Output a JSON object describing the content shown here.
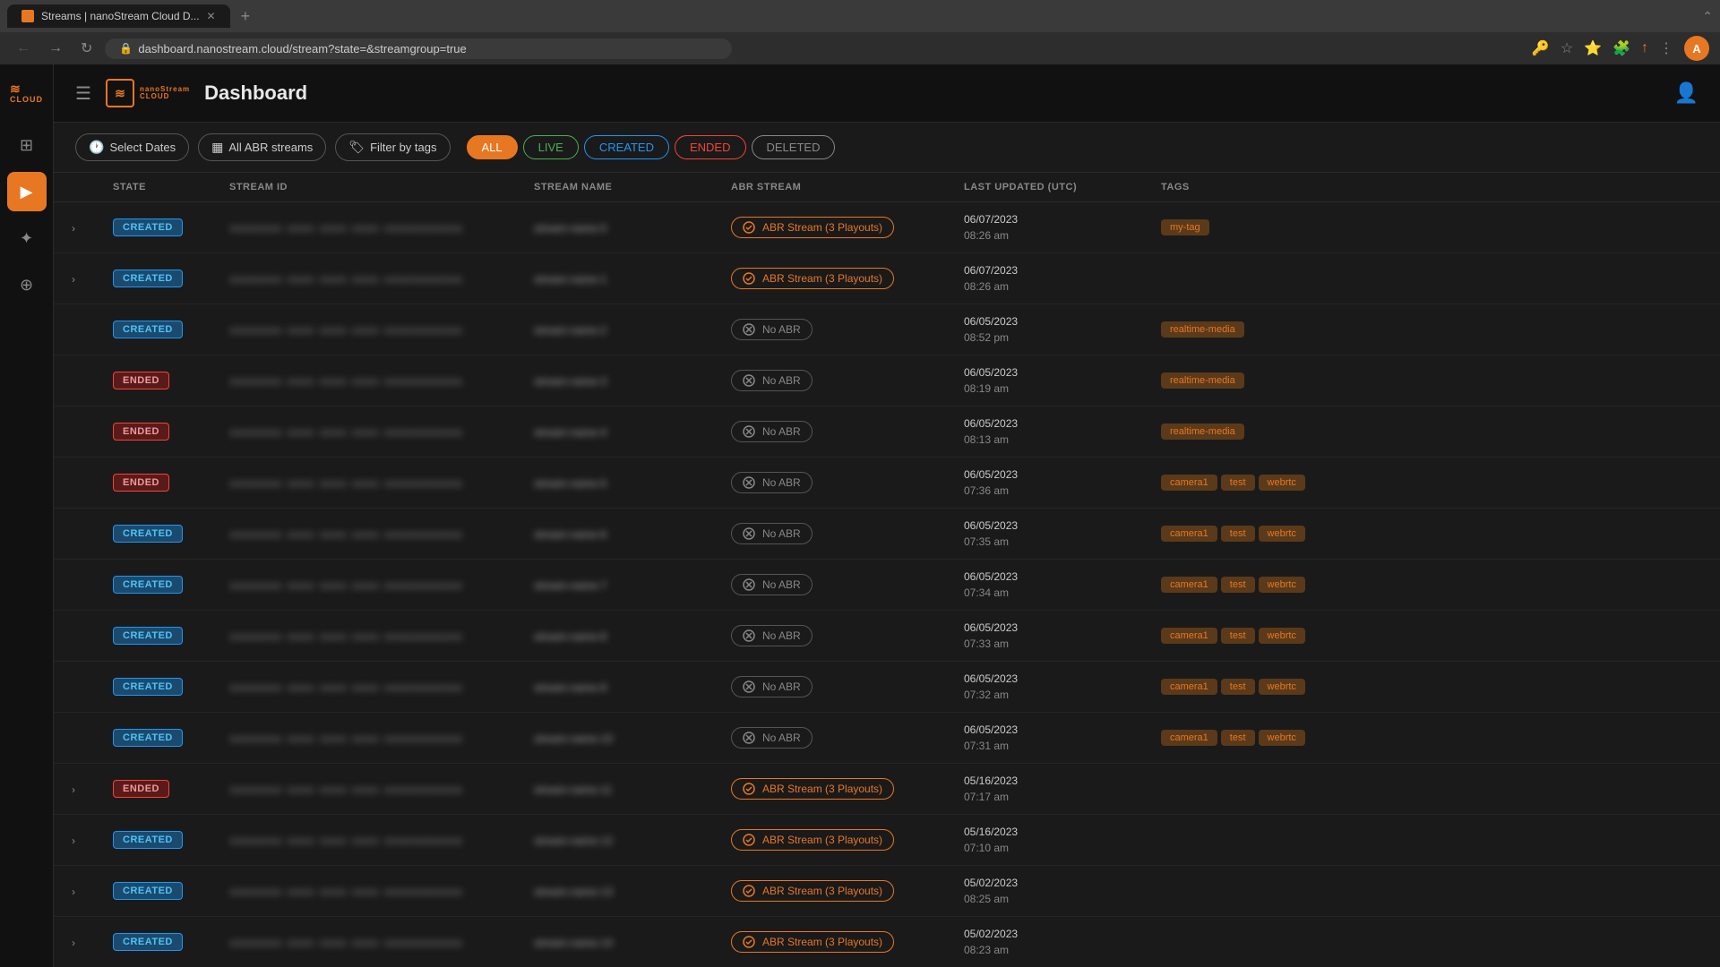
{
  "browser": {
    "tab_label": "Streams | nanoStream Cloud D...",
    "url": "dashboard.nanostream.cloud/stream?state=&streamgroup=true",
    "new_tab_label": "+",
    "profile_initial": "A"
  },
  "header": {
    "title": "Dashboard",
    "hamburger_label": "☰",
    "user_icon": "👤"
  },
  "toolbar": {
    "select_dates_label": "Select Dates",
    "all_abr_streams_label": "All ABR streams",
    "filter_by_tags_label": "Filter by tags",
    "tabs": [
      {
        "id": "all",
        "label": "ALL",
        "state": "active-all"
      },
      {
        "id": "live",
        "label": "LIVE",
        "state": "active-live"
      },
      {
        "id": "created",
        "label": "CREATED",
        "state": "active-created"
      },
      {
        "id": "ended",
        "label": "ENDED",
        "state": "active-ended"
      },
      {
        "id": "deleted",
        "label": "DELETED",
        "state": "active-deleted"
      }
    ]
  },
  "table": {
    "columns": [
      "",
      "STATE",
      "STREAM ID",
      "STREAM NAME",
      "ABR STREAM",
      "LAST UPDATED (UTC)",
      "TAGS"
    ],
    "rows": [
      {
        "expandable": true,
        "state": "CREATED",
        "stream_id": "██████████████████████████████",
        "stream_name": "████████████",
        "abr": "abr",
        "abr_label": "ABR Stream (3 Playouts)",
        "date": "06/07/2023",
        "time": "08:26 am",
        "tags": [
          "my-tag"
        ]
      },
      {
        "expandable": true,
        "state": "CREATED",
        "stream_id": "██████████████████████████████",
        "stream_name": "████████████",
        "abr": "abr",
        "abr_label": "ABR Stream (3 Playouts)",
        "date": "06/07/2023",
        "time": "08:26 am",
        "tags": []
      },
      {
        "expandable": false,
        "state": "CREATED",
        "stream_id": "██████████████████████████████",
        "stream_name": "████████████",
        "abr": "none",
        "abr_label": "No ABR",
        "date": "06/05/2023",
        "time": "08:52 pm",
        "tags": [
          "realtime-media"
        ]
      },
      {
        "expandable": false,
        "state": "ENDED",
        "stream_id": "██████████████████████████████",
        "stream_name": "████████████",
        "abr": "none",
        "abr_label": "No ABR",
        "date": "06/05/2023",
        "time": "08:19 am",
        "tags": [
          "realtime-media"
        ]
      },
      {
        "expandable": false,
        "state": "ENDED",
        "stream_id": "██████████████████████████████",
        "stream_name": "████████████",
        "abr": "none",
        "abr_label": "No ABR",
        "date": "06/05/2023",
        "time": "08:13 am",
        "tags": [
          "realtime-media"
        ]
      },
      {
        "expandable": false,
        "state": "ENDED",
        "stream_id": "██████████████████████████████",
        "stream_name": "████████████",
        "abr": "none",
        "abr_label": "No ABR",
        "date": "06/05/2023",
        "time": "07:36 am",
        "tags": [
          "camera1",
          "test",
          "webrtc"
        ]
      },
      {
        "expandable": false,
        "state": "CREATED",
        "stream_id": "██████████████████████████████",
        "stream_name": "████████████",
        "abr": "none",
        "abr_label": "No ABR",
        "date": "06/05/2023",
        "time": "07:35 am",
        "tags": [
          "camera1",
          "test",
          "webrtc"
        ]
      },
      {
        "expandable": false,
        "state": "CREATED",
        "stream_id": "██████████████████████████████",
        "stream_name": "████████████",
        "abr": "none",
        "abr_label": "No ABR",
        "date": "06/05/2023",
        "time": "07:34 am",
        "tags": [
          "camera1",
          "test",
          "webrtc"
        ]
      },
      {
        "expandable": false,
        "state": "CREATED",
        "stream_id": "██████████████████████████████",
        "stream_name": "████████████",
        "abr": "none",
        "abr_label": "No ABR",
        "date": "06/05/2023",
        "time": "07:33 am",
        "tags": [
          "camera1",
          "test",
          "webrtc"
        ]
      },
      {
        "expandable": false,
        "state": "CREATED",
        "stream_id": "██████████████████████████████",
        "stream_name": "████████████",
        "abr": "none",
        "abr_label": "No ABR",
        "date": "06/05/2023",
        "time": "07:32 am",
        "tags": [
          "camera1",
          "test",
          "webrtc"
        ]
      },
      {
        "expandable": false,
        "state": "CREATED",
        "stream_id": "██████████████████████████████",
        "stream_name": "████████████",
        "abr": "none",
        "abr_label": "No ABR",
        "date": "06/05/2023",
        "time": "07:31 am",
        "tags": [
          "camera1",
          "test",
          "webrtc"
        ]
      },
      {
        "expandable": true,
        "state": "ENDED",
        "stream_id": "██████████████████████████████",
        "stream_name": "████████████",
        "abr": "abr",
        "abr_label": "ABR Stream (3 Playouts)",
        "date": "05/16/2023",
        "time": "07:17 am",
        "tags": []
      },
      {
        "expandable": true,
        "state": "CREATED",
        "stream_id": "██████████████████████████████",
        "stream_name": "████████████",
        "abr": "abr",
        "abr_label": "ABR Stream (3 Playouts)",
        "date": "05/16/2023",
        "time": "07:10 am",
        "tags": []
      },
      {
        "expandable": true,
        "state": "CREATED",
        "stream_id": "██████████████████████████████",
        "stream_name": "████████████",
        "abr": "abr",
        "abr_label": "ABR Stream (3 Playouts)",
        "date": "05/02/2023",
        "time": "08:25 am",
        "tags": []
      },
      {
        "expandable": true,
        "state": "CREATED",
        "stream_id": "██████████████████████████████",
        "stream_name": "████████████",
        "abr": "abr",
        "abr_label": "ABR Stream (3 Playouts)",
        "date": "05/02/2023",
        "time": "08:23 am",
        "tags": []
      }
    ]
  },
  "sidebar": {
    "items": [
      {
        "id": "dashboard",
        "icon": "⊞",
        "active": false
      },
      {
        "id": "streams",
        "icon": "▶",
        "active": true
      },
      {
        "id": "analytics",
        "icon": "✦",
        "active": false
      },
      {
        "id": "add",
        "icon": "⊕",
        "active": false
      }
    ]
  }
}
